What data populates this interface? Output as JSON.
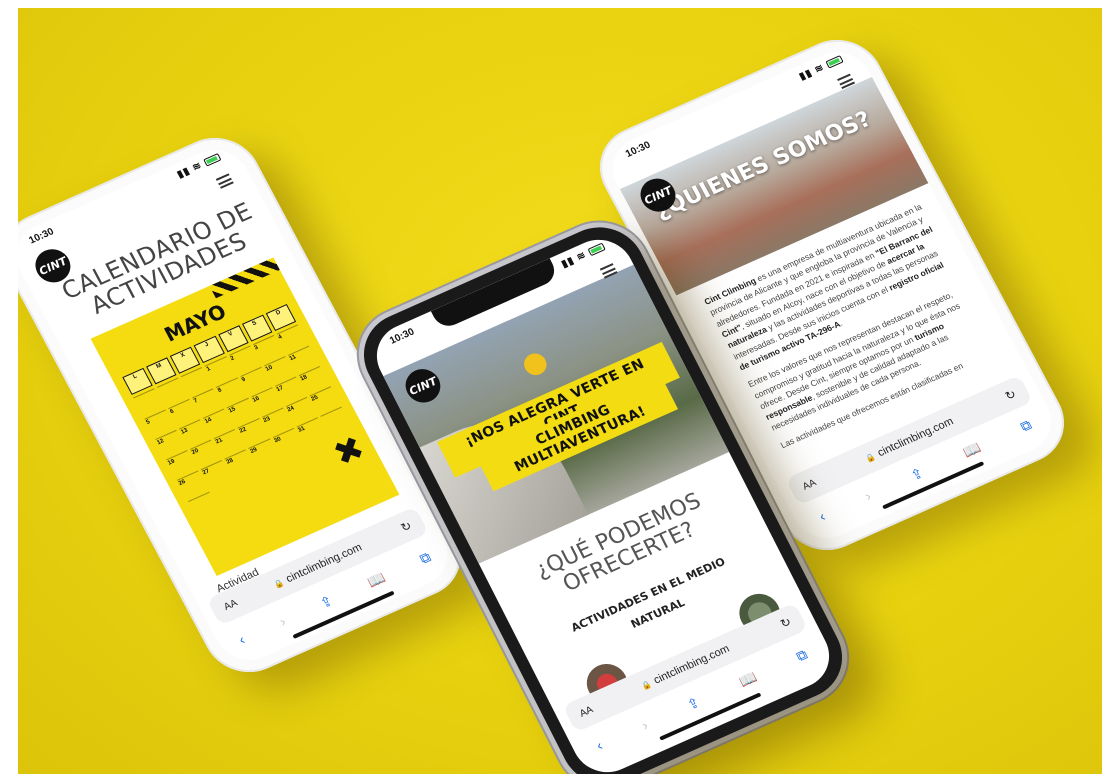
{
  "status": {
    "time": "10:30"
  },
  "logo_text": "CINT",
  "url": "cintclimbing.com",
  "browser": {
    "aa": "AA",
    "reload": "↻",
    "lock": "🔒"
  },
  "left_phone": {
    "title_line1": "CALENDARIO DE",
    "title_line2": "ACTIVIDADES",
    "poster_month": "MAYO",
    "weekdays": [
      "L",
      "M",
      "X",
      "J",
      "V",
      "S",
      "D"
    ],
    "days": [
      "",
      "",
      "",
      "1",
      "2",
      "3",
      "4",
      "5",
      "6",
      "7",
      "8",
      "9",
      "10",
      "11",
      "12",
      "13",
      "14",
      "15",
      "16",
      "17",
      "18",
      "19",
      "20",
      "21",
      "22",
      "23",
      "24",
      "25",
      "26",
      "27",
      "28",
      "29",
      "30",
      "31",
      "",
      ""
    ],
    "below_poster": "Actividad"
  },
  "center_phone": {
    "banner_line1": "¡NOS ALEGRA VERTE EN CINT",
    "banner_line2": "CLIMBING MULTIAVENTURA!",
    "offer_line1": "¿QUÉ PODEMOS",
    "offer_line2": "OFRECERTE?",
    "sub_line1": "ACTIVIDADES EN EL MEDIO",
    "sub_line2": "NATURAL"
  },
  "right_phone": {
    "hero_title": "¿QUIENES SOMOS?",
    "p1_brand": "Cint Climbing",
    "p1_a": " es una empresa de multiaventura ubicada en la provincia de Alicante y que engloba la provincia de Valencia y alrededores. Fundada en 2021 e inspirada en ",
    "p1_b": "\"El Barranc del Cint\"",
    "p1_c": ", situado en Alcoy, nace con el objetivo de ",
    "p1_d": "acercar la naturaleza",
    "p1_e": " y las actividades deportivas a todas las personas interesadas. Desde sus inicios cuenta con el ",
    "p1_f": "registro oficial de turismo activo TA-296-A",
    "p1_g": ".",
    "p2_a": "Entre los valores que nos representan destacan el respeto, compromiso y gratitud hacia la naturaleza y lo que ésta nos ofrece. Desde Cint, siempre optamos por un ",
    "p2_b": "turismo responsable",
    "p2_c": ", sostenible y de calidad adaptado a las necesidades individuales de cada persona.",
    "p3": "Las actividades que ofrecemos están clasificadas en"
  },
  "colors": {
    "background": "#e8d20f",
    "accent_yellow": "#f3dc12",
    "ios_blue": "#1f6fe5"
  }
}
